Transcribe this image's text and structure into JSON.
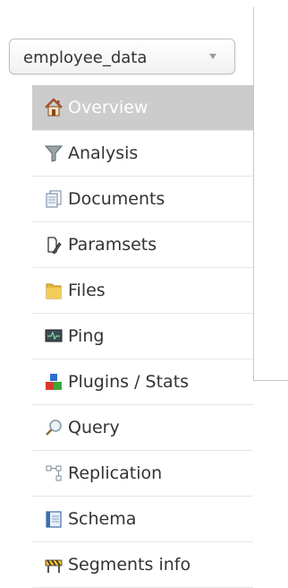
{
  "core_selector": {
    "selected": "employee_data"
  },
  "menu": {
    "items": [
      {
        "label": "Overview",
        "icon": "home-icon",
        "active": true
      },
      {
        "label": "Analysis",
        "icon": "funnel-icon",
        "active": false
      },
      {
        "label": "Documents",
        "icon": "documents-icon",
        "active": false
      },
      {
        "label": "Paramsets",
        "icon": "paramsets-icon",
        "active": false
      },
      {
        "label": "Files",
        "icon": "folder-icon",
        "active": false
      },
      {
        "label": "Ping",
        "icon": "monitor-icon",
        "active": false
      },
      {
        "label": "Plugins / Stats",
        "icon": "blocks-icon",
        "active": false
      },
      {
        "label": "Query",
        "icon": "magnifier-icon",
        "active": false
      },
      {
        "label": "Replication",
        "icon": "replication-icon",
        "active": false
      },
      {
        "label": "Schema",
        "icon": "book-icon",
        "active": false
      },
      {
        "label": "Segments info",
        "icon": "construction-icon",
        "active": false
      }
    ]
  },
  "colors": {
    "active_background": "#cccccc",
    "active_text": "#ffffff",
    "text": "#333333",
    "divider": "#e6e6e6"
  }
}
